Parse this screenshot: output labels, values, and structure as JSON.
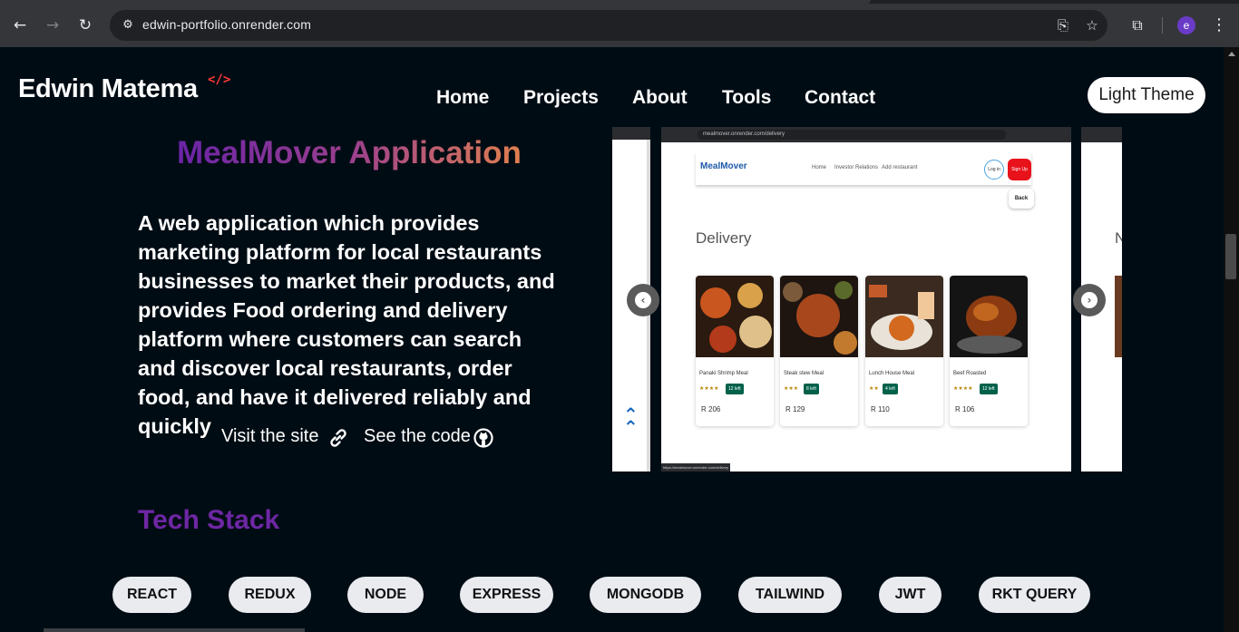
{
  "browser": {
    "url": "edwin-portfolio.onrender.com",
    "profile_initial": "e"
  },
  "header": {
    "logo": "Edwin Matema",
    "logo_mark": "</>",
    "nav": [
      "Home",
      "Projects",
      "About",
      "Tools",
      "Contact"
    ],
    "theme_button": "Light Theme"
  },
  "project": {
    "title": "MealMover Application",
    "description": "A web application which provides marketing platform for local restaurants businesses to market their products, and provides Food ordering and delivery platform where customers can search and discover local restaurants, order food, and have it delivered reliably and quickly",
    "visit_label": "Visit the site",
    "code_label": "See the code"
  },
  "screenshot": {
    "browser_url": "mealmover.onrender.com/delivery",
    "app_logo": "MealMover",
    "app_nav": [
      "Home",
      "Investor Relations",
      "Add restaurant"
    ],
    "login": "Log in",
    "signup": "Sign Up",
    "back": "Back",
    "heading": "Delivery",
    "right_peek_heading": "N",
    "status_url": "https://mealmover.onrender.com/delivery",
    "meals": [
      {
        "name": "Panaki Shrimp Meal",
        "rating": "★★★★",
        "badge": "12 left",
        "price": "R 206"
      },
      {
        "name": "Steak stew Meal",
        "rating": "★★★",
        "badge": "8 left",
        "price": "R 129"
      },
      {
        "name": "Lunch House Meal",
        "rating": "★★",
        "badge": "4 left",
        "price": "R 110"
      },
      {
        "name": "Beef Roasted",
        "rating": "★★★★",
        "badge": "12 left",
        "price": "R 106"
      }
    ]
  },
  "tech_stack": {
    "title": "Tech Stack",
    "items": [
      "REACT",
      "REDUX",
      "NODE",
      "EXPRESS",
      "MONGODB",
      "TAILWIND",
      "JWT",
      "RKT QUERY"
    ]
  },
  "colors": {
    "page_bg": "#000c14",
    "title_gradient_start": "#6a24a6",
    "title_gradient_end": "#e07f4f",
    "tech_title": "#6e27a4",
    "pill_bg": "#e9ebef"
  }
}
